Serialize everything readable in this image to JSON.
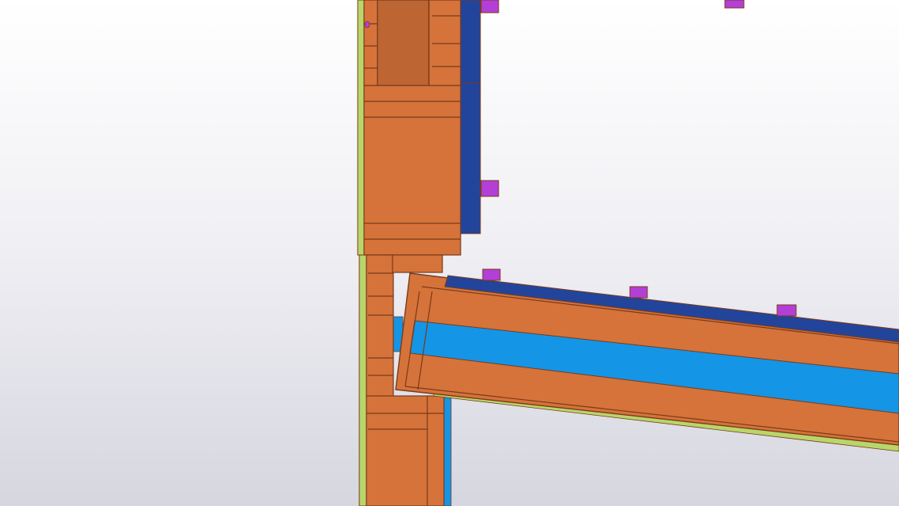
{
  "view": {
    "kind": "3d-model-viewport",
    "background": {
      "top": "#ffffff",
      "bottom": "#d6d6e0"
    }
  },
  "materials": {
    "timber": "#d5733a",
    "timber_dark": "#bd6533",
    "timber_edge": "#7a3a1a",
    "sheathing": "#23449b",
    "insulation": "#1495e6",
    "membrane": "#b8d66a",
    "fastener": "#b43fd6"
  },
  "elements": [
    "wall-stud",
    "wall-sheathing-board",
    "rafter",
    "roof-sheathing-board",
    "insulation",
    "membrane",
    "fastener"
  ]
}
